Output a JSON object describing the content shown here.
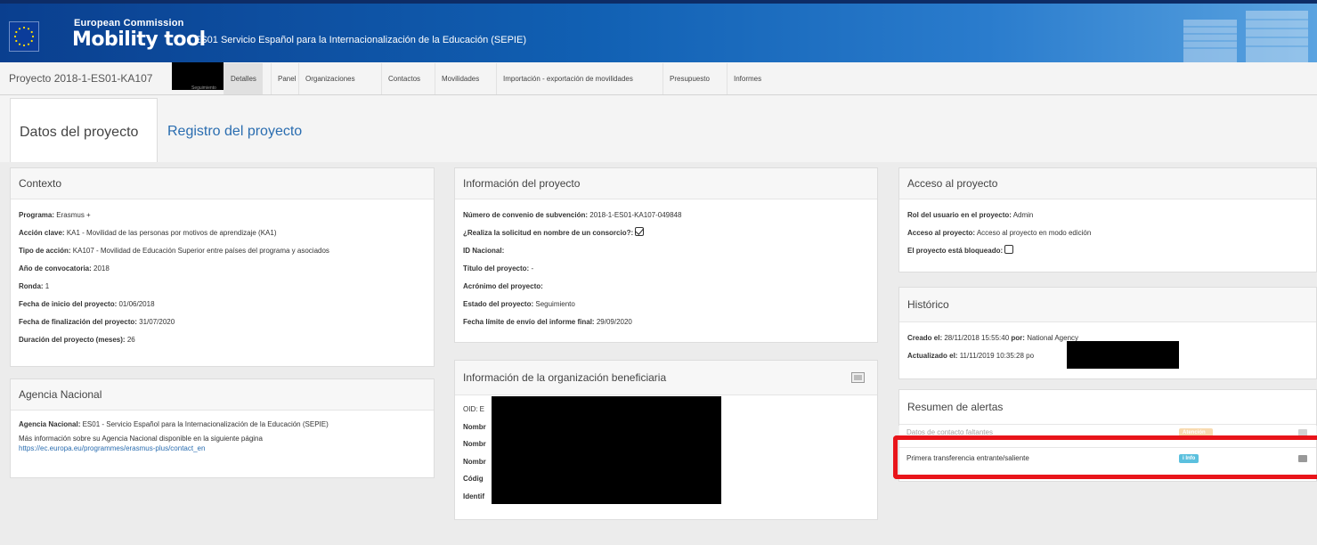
{
  "header": {
    "commission": "European Commission",
    "app_name": "Mobility tool",
    "title": "ES01 Servicio Español para la Internacionalización de la Educación (SEPIE)"
  },
  "navbar": {
    "project_label": "Proyecto 2018-1-ES01-KA107",
    "project_sub": "Seguimiento",
    "tabs": [
      "Detalles",
      "Panel",
      "Organizaciones",
      "Contactos",
      "Movilidades",
      "Importación - exportación de movilidades",
      "Presupuesto",
      "Informes"
    ],
    "active_tab": "Detalles"
  },
  "page_tabs": {
    "datos": "Datos del proyecto",
    "registro": "Registro del proyecto"
  },
  "contexto": {
    "title": "Contexto",
    "rows": [
      {
        "label": "Programa:",
        "value": "Erasmus +"
      },
      {
        "label": "Acción clave:",
        "value": "KA1 - Movilidad de las personas por motivos de aprendizaje (KA1)"
      },
      {
        "label": "Tipo de acción:",
        "value": "KA107 - Movilidad de Educación Superior entre países del programa y asociados"
      },
      {
        "label": "Año de convocatoria:",
        "value": "2018"
      },
      {
        "label": "Ronda:",
        "value": "1"
      },
      {
        "label": "Fecha de inicio del proyecto:",
        "value": "01/06/2018"
      },
      {
        "label": "Fecha de finalización del proyecto:",
        "value": "31/07/2020"
      },
      {
        "label": "Duración del proyecto (meses):",
        "value": "26"
      }
    ]
  },
  "agencia": {
    "title": "Agencia Nacional",
    "label": "Agencia Nacional:",
    "value": "ES01 - Servicio Español para la Internacionalización de la Educación (SEPIE)",
    "info_text": "Más información sobre su Agencia Nacional disponible en la siguiente página",
    "link": "https://ec.europa.eu/programmes/erasmus-plus/contact_en"
  },
  "informacion": {
    "title": "Información del proyecto",
    "rows": [
      {
        "label": "Número de convenio de subvención:",
        "value": "2018-1-ES01-KA107-049848"
      },
      {
        "label": "¿Realiza la solicitud en nombre de un consorcio?:",
        "value": ""
      },
      {
        "label": "ID Nacional:",
        "value": ""
      },
      {
        "label": "Título del proyecto:",
        "value": "-"
      },
      {
        "label": "Acrónimo del proyecto:",
        "value": ""
      },
      {
        "label": "Estado del proyecto:",
        "value": "Seguimiento"
      },
      {
        "label": "Fecha límite de envío del informe final:",
        "value": "29/09/2020"
      }
    ],
    "consorcio_checked": true
  },
  "beneficiaria": {
    "title": "Información de la organización beneficiaria",
    "rows": [
      "OID: E",
      "Nombr",
      "Nombr",
      "Nombr",
      "Códig",
      "Identif"
    ]
  },
  "acceso": {
    "title": "Acceso al proyecto",
    "rows": [
      {
        "label": "Rol del usuario en el proyecto:",
        "value": "Admin"
      },
      {
        "label": "Acceso al proyecto:",
        "value": "Acceso al proyecto en modo edición"
      },
      {
        "label": "El proyecto está bloqueado:",
        "value": ""
      }
    ],
    "bloqueado_checked": false
  },
  "historico": {
    "title": "Histórico",
    "rows": [
      {
        "label": "Creado el:",
        "value": "28/11/2018 15:55:40",
        "by_label": "por:",
        "by": "National Agency"
      },
      {
        "label": "Actualizado el:",
        "value": "11/11/2019 10:35:28",
        "by_label": "po",
        "by": ""
      }
    ]
  },
  "alertas": {
    "title": "Resumen de alertas",
    "rows": [
      {
        "text": "Datos de contacto faltantes",
        "badge": "Atención",
        "badge_color": "#f0ad4e"
      },
      {
        "text": "Primera transferencia entrante/saliente",
        "badge": "i Info",
        "badge_color": "#5bc0de"
      }
    ]
  }
}
